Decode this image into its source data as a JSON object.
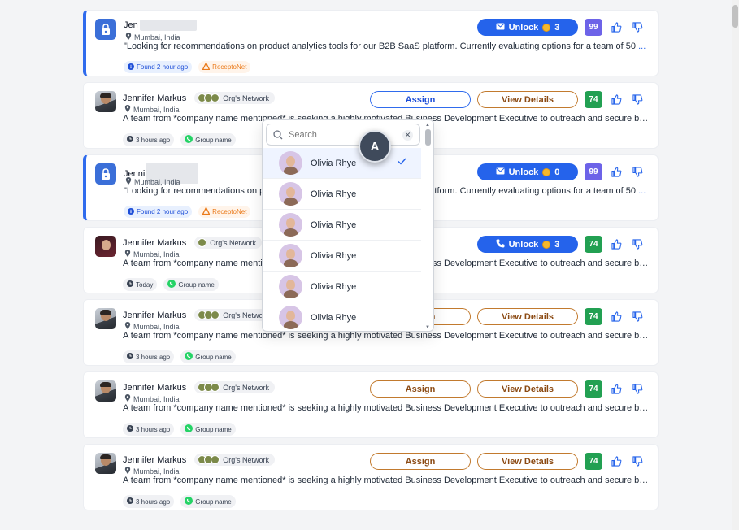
{
  "colors": {
    "primary": "#2563eb",
    "assign_border": "#2f6bed",
    "details_border": "#c27a2e",
    "score_green": "#22a052",
    "score_purple": "#6d63e8",
    "whatsapp": "#25d366",
    "orange_tag": "#ea7a1a"
  },
  "cards": [
    {
      "kind": "locked",
      "name": "Jen",
      "location": "Mumbai, India",
      "desc": "\"Looking for recommendations on product analytics tools for our B2B SaaS platform. Currently evaluating options for a team of 50",
      "more": "...",
      "tag1": "Found 2 hour ago",
      "tag2": "ReceptoNet",
      "unlock": "Unlock",
      "coins": "3",
      "score": "99"
    },
    {
      "kind": "lead",
      "name": "Jennifer Markus",
      "location": "Mumbai, India",
      "network": "Org's Network",
      "desc": "A team from *company name mentioned* is seeking a highly motivated Business Development Executive to outreach and secure bo...",
      "time": "3 hours ago",
      "group": "Group name",
      "assign": "Assign",
      "details": "View Details",
      "score": "74"
    },
    {
      "kind": "locked",
      "name": "Jenni",
      "location": "Mumbai, India",
      "desc": "\"Looking for recommendations on product analytics tools for our B2B SaaS platform. Currently evaluating options for a team of 50",
      "more": "...",
      "tag1": "Found 2 hour ago",
      "tag2": "ReceptoNet",
      "unlock": "Unlock",
      "coins": "0",
      "score": "99"
    },
    {
      "kind": "phone",
      "name": "Jennifer Markus",
      "location": "Mumbai, India",
      "network": "Org's Network",
      "desc": "A team from *company name mentioned* is seeking a highly motivated Business Development Executive to outreach and secure bo...",
      "time": "Today",
      "group": "Group name",
      "unlock": "Unlock",
      "coins": "3",
      "score": "74"
    },
    {
      "kind": "lead",
      "name": "Jennifer Markus",
      "location": "Mumbai, India",
      "network": "Org's Network",
      "desc": "A team from *company name mentioned* is seeking a highly motivated Business Development Executive to outreach and secure bo...",
      "time": "3 hours ago",
      "group": "Group name",
      "assign": "Assign",
      "details": "View Details",
      "score": "74"
    },
    {
      "kind": "lead",
      "name": "Jennifer Markus",
      "location": "Mumbai, India",
      "network": "Org's Network",
      "desc": "A team from *company name mentioned* is seeking a highly motivated Business Development Executive to outreach and secure bo...",
      "time": "3 hours ago",
      "group": "Group name",
      "assign": "Assign",
      "details": "View Details",
      "score": "74"
    },
    {
      "kind": "lead",
      "name": "Jennifer Markus",
      "location": "Mumbai, India",
      "network": "Org's Network",
      "desc": "A team from *company name mentioned* is seeking a highly motivated Business Development Executive to outreach and secure bo...",
      "time": "3 hours ago",
      "group": "Group name",
      "assign": "Assign",
      "details": "View Details",
      "score": "74"
    }
  ],
  "dropdown": {
    "placeholder": "Search",
    "items": [
      {
        "name": "Olivia Rhye",
        "selected": true
      },
      {
        "name": "Olivia Rhye",
        "selected": false
      },
      {
        "name": "Olivia Rhye",
        "selected": false
      },
      {
        "name": "Olivia Rhye",
        "selected": false
      },
      {
        "name": "Olivia Rhye",
        "selected": false
      },
      {
        "name": "Olivia Rhye",
        "selected": false
      }
    ]
  },
  "cursor_badge": "A"
}
